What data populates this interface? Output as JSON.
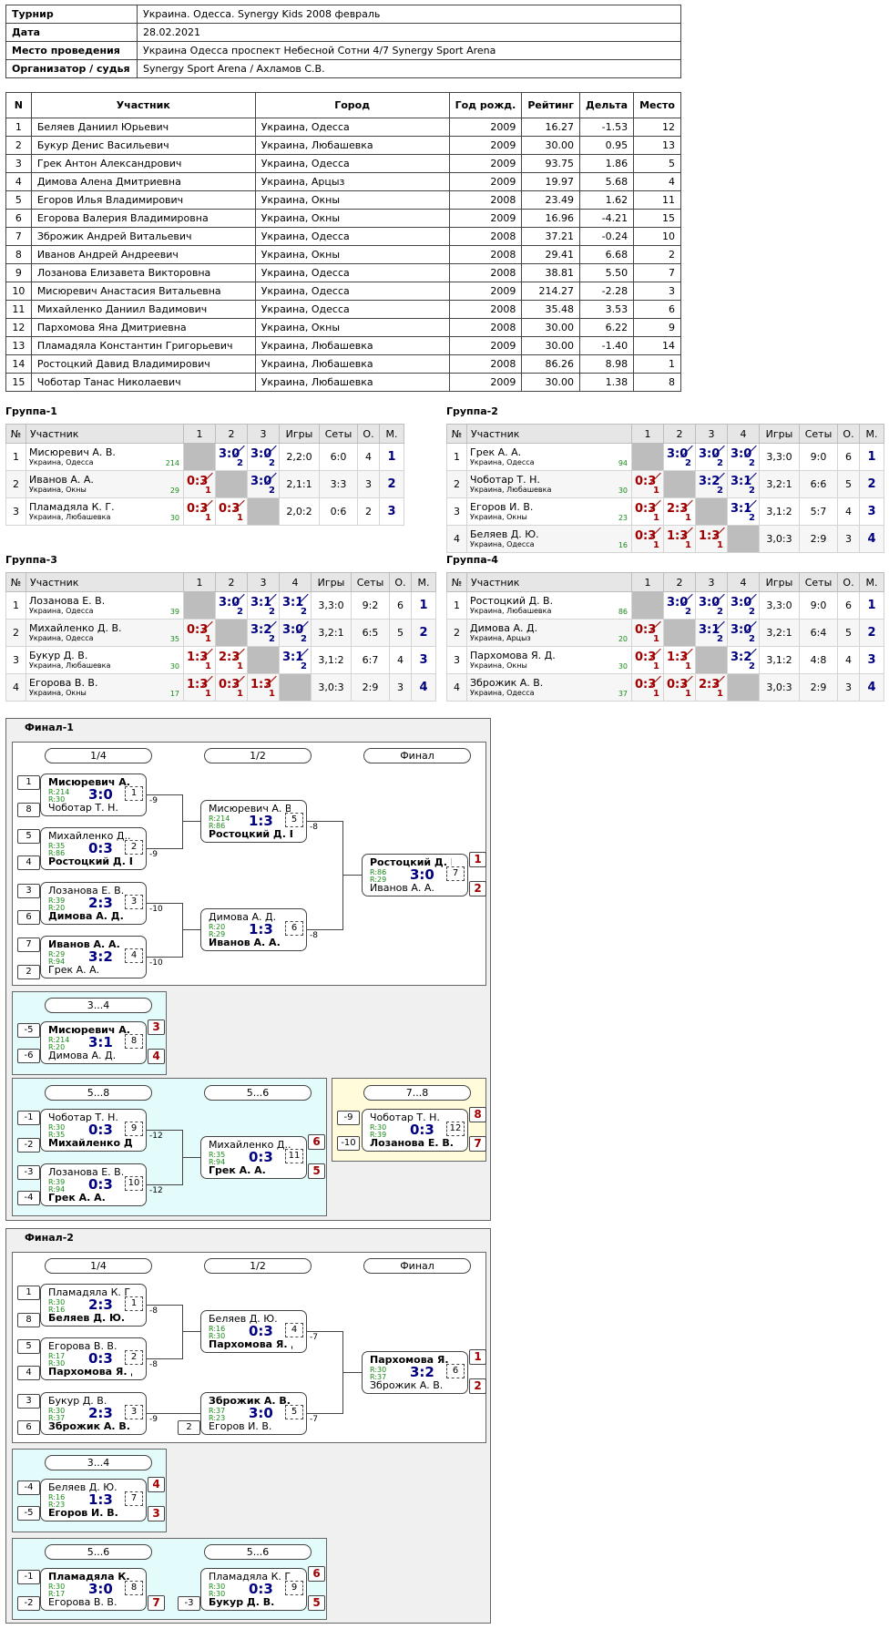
{
  "info": [
    [
      "Турнир",
      "Украина. Одесса. Synergy Kids 2008 февраль"
    ],
    [
      "Дата",
      "28.02.2021"
    ],
    [
      "Место проведения",
      "Украина Одесса проспект Небесной Сотни 4/7 Synergy Sport Arena"
    ],
    [
      "Организатор / судья",
      "Synergy Sport Arena / Ахламов С.В."
    ]
  ],
  "main": {
    "headers": [
      "N",
      "Участник",
      "Город",
      "Год рожд.",
      "Рейтинг",
      "Дельта",
      "Место"
    ],
    "rows": [
      [
        "1",
        "Беляев Даниил Юрьевич",
        "Украина, Одесса",
        "2009",
        "16.27",
        "-1.53",
        "12"
      ],
      [
        "2",
        "Букур Денис Васильевич",
        "Украина, Любашевка",
        "2009",
        "30.00",
        "0.95",
        "13"
      ],
      [
        "3",
        "Грек Антон Александрович",
        "Украина, Одесса",
        "2009",
        "93.75",
        "1.86",
        "5"
      ],
      [
        "4",
        "Димова Алена Дмитриевна",
        "Украина, Арцыз",
        "2009",
        "19.97",
        "5.68",
        "4"
      ],
      [
        "5",
        "Егоров Илья Владимирович",
        "Украина, Окны",
        "2008",
        "23.49",
        "1.62",
        "11"
      ],
      [
        "6",
        "Егорова Валерия Владимировна",
        "Украина, Окны",
        "2009",
        "16.96",
        "-4.21",
        "15"
      ],
      [
        "7",
        "Зброжик Андрей Витальевич",
        "Украина, Одесса",
        "2008",
        "37.21",
        "-0.24",
        "10"
      ],
      [
        "8",
        "Иванов Андрей Андреевич",
        "Украина, Окны",
        "2008",
        "29.41",
        "6.68",
        "2"
      ],
      [
        "9",
        "Лозанова Елизавета Викторовна",
        "Украина, Одесса",
        "2008",
        "38.81",
        "5.50",
        "7"
      ],
      [
        "10",
        "Мисюревич Анастасия Витальевна",
        "Украина, Одесса",
        "2009",
        "214.27",
        "-2.28",
        "3"
      ],
      [
        "11",
        "Михайленко Даниил Вадимович",
        "Украина, Одесса",
        "2008",
        "35.48",
        "3.53",
        "6"
      ],
      [
        "12",
        "Пархомова Яна Дмитриевна",
        "Украина, Окны",
        "2008",
        "30.00",
        "6.22",
        "9"
      ],
      [
        "13",
        "Пламадяла Константин Григорьевич",
        "Украина, Любашевка",
        "2009",
        "30.00",
        "-1.40",
        "14"
      ],
      [
        "14",
        "Ростоцкий Давид Владимирович",
        "Украина, Любашевка",
        "2008",
        "86.26",
        "8.98",
        "1"
      ],
      [
        "15",
        "Чоботар Танас Николаевич",
        "Украина, Любашевка",
        "2009",
        "30.00",
        "1.38",
        "8"
      ]
    ]
  },
  "groups": [
    {
      "title": "Группа-1",
      "headers": [
        "№",
        "Участник",
        "1",
        "2",
        "3",
        "Игры",
        "Сеты",
        "О.",
        "М."
      ],
      "rows": [
        {
          "n": "1",
          "name": "Мисюревич А. В.",
          "city": "Украина, Одесса",
          "r": "214",
          "sc": [
            null,
            [
              "3:0",
              "2",
              "w"
            ],
            [
              "3:0",
              "2",
              "w"
            ]
          ],
          "games": "2,2:0",
          "sets": "6:0",
          "pts": "4",
          "place": "1"
        },
        {
          "n": "2",
          "name": "Иванов А. А.",
          "city": "Украина, Окны",
          "r": "29",
          "sc": [
            [
              "0:3",
              "1",
              "l"
            ],
            null,
            [
              "3:0",
              "2",
              "w"
            ]
          ],
          "games": "2,1:1",
          "sets": "3:3",
          "pts": "3",
          "place": "2"
        },
        {
          "n": "3",
          "name": "Пламадяла К. Г.",
          "city": "Украина, Любашевка",
          "r": "30",
          "sc": [
            [
              "0:3",
              "1",
              "l"
            ],
            [
              "0:3",
              "1",
              "l"
            ],
            null
          ],
          "games": "2,0:2",
          "sets": "0:6",
          "pts": "2",
          "place": "3"
        }
      ]
    },
    {
      "title": "Группа-2",
      "headers": [
        "№",
        "Участник",
        "1",
        "2",
        "3",
        "4",
        "Игры",
        "Сеты",
        "О.",
        "М."
      ],
      "rows": [
        {
          "n": "1",
          "name": "Грек А. А.",
          "city": "Украина, Одесса",
          "r": "94",
          "sc": [
            null,
            [
              "3:0",
              "2",
              "w"
            ],
            [
              "3:0",
              "2",
              "w"
            ],
            [
              "3:0",
              "2",
              "w"
            ]
          ],
          "games": "3,3:0",
          "sets": "9:0",
          "pts": "6",
          "place": "1"
        },
        {
          "n": "2",
          "name": "Чоботар Т. Н.",
          "city": "Украина, Любашевка",
          "r": "30",
          "sc": [
            [
              "0:3",
              "1",
              "l"
            ],
            null,
            [
              "3:2",
              "2",
              "w"
            ],
            [
              "3:1",
              "2",
              "w"
            ]
          ],
          "games": "3,2:1",
          "sets": "6:6",
          "pts": "5",
          "place": "2"
        },
        {
          "n": "3",
          "name": "Егоров И. В.",
          "city": "Украина, Окны",
          "r": "23",
          "sc": [
            [
              "0:3",
              "1",
              "l"
            ],
            [
              "2:3",
              "1",
              "l"
            ],
            null,
            [
              "3:1",
              "2",
              "w"
            ]
          ],
          "games": "3,1:2",
          "sets": "5:7",
          "pts": "4",
          "place": "3"
        },
        {
          "n": "4",
          "name": "Беляев Д. Ю.",
          "city": "Украина, Одесса",
          "r": "16",
          "sc": [
            [
              "0:3",
              "1",
              "l"
            ],
            [
              "1:3",
              "1",
              "l"
            ],
            [
              "1:3",
              "1",
              "l"
            ],
            null
          ],
          "games": "3,0:3",
          "sets": "2:9",
          "pts": "3",
          "place": "4"
        }
      ]
    },
    {
      "title": "Группа-3",
      "headers": [
        "№",
        "Участник",
        "1",
        "2",
        "3",
        "4",
        "Игры",
        "Сеты",
        "О.",
        "М."
      ],
      "rows": [
        {
          "n": "1",
          "name": "Лозанова Е. В.",
          "city": "Украина, Одесса",
          "r": "39",
          "sc": [
            null,
            [
              "3:0",
              "2",
              "w"
            ],
            [
              "3:1",
              "2",
              "w"
            ],
            [
              "3:1",
              "2",
              "w"
            ]
          ],
          "games": "3,3:0",
          "sets": "9:2",
          "pts": "6",
          "place": "1"
        },
        {
          "n": "2",
          "name": "Михайленко Д. В.",
          "city": "Украина, Одесса",
          "r": "35",
          "sc": [
            [
              "0:3",
              "1",
              "l"
            ],
            null,
            [
              "3:2",
              "2",
              "w"
            ],
            [
              "3:0",
              "2",
              "w"
            ]
          ],
          "games": "3,2:1",
          "sets": "6:5",
          "pts": "5",
          "place": "2"
        },
        {
          "n": "3",
          "name": "Букур Д. В.",
          "city": "Украина, Любашевка",
          "r": "30",
          "sc": [
            [
              "1:3",
              "1",
              "l"
            ],
            [
              "2:3",
              "1",
              "l"
            ],
            null,
            [
              "3:1",
              "2",
              "w"
            ]
          ],
          "games": "3,1:2",
          "sets": "6:7",
          "pts": "4",
          "place": "3"
        },
        {
          "n": "4",
          "name": "Егорова В. В.",
          "city": "Украина, Окны",
          "r": "17",
          "sc": [
            [
              "1:3",
              "1",
              "l"
            ],
            [
              "0:3",
              "1",
              "l"
            ],
            [
              "1:3",
              "1",
              "l"
            ],
            null
          ],
          "games": "3,0:3",
          "sets": "2:9",
          "pts": "3",
          "place": "4"
        }
      ]
    },
    {
      "title": "Группа-4",
      "headers": [
        "№",
        "Участник",
        "1",
        "2",
        "3",
        "4",
        "Игры",
        "Сеты",
        "О.",
        "М."
      ],
      "rows": [
        {
          "n": "1",
          "name": "Ростоцкий Д. В.",
          "city": "Украина, Любашевка",
          "r": "86",
          "sc": [
            null,
            [
              "3:0",
              "2",
              "w"
            ],
            [
              "3:0",
              "2",
              "w"
            ],
            [
              "3:0",
              "2",
              "w"
            ]
          ],
          "games": "3,3:0",
          "sets": "9:0",
          "pts": "6",
          "place": "1"
        },
        {
          "n": "2",
          "name": "Димова А. Д.",
          "city": "Украина, Арцыз",
          "r": "20",
          "sc": [
            [
              "0:3",
              "1",
              "l"
            ],
            null,
            [
              "3:1",
              "2",
              "w"
            ],
            [
              "3:0",
              "2",
              "w"
            ]
          ],
          "games": "3,2:1",
          "sets": "6:4",
          "pts": "5",
          "place": "2"
        },
        {
          "n": "3",
          "name": "Пархомова Я. Д.",
          "city": "Украина, Окны",
          "r": "30",
          "sc": [
            [
              "0:3",
              "1",
              "l"
            ],
            [
              "1:3",
              "1",
              "l"
            ],
            null,
            [
              "3:2",
              "2",
              "w"
            ]
          ],
          "games": "3,1:2",
          "sets": "4:8",
          "pts": "4",
          "place": "3"
        },
        {
          "n": "4",
          "name": "Зброжик А. В.",
          "city": "Украина, Одесса",
          "r": "37",
          "sc": [
            [
              "0:3",
              "1",
              "l"
            ],
            [
              "0:3",
              "1",
              "l"
            ],
            [
              "2:3",
              "1",
              "l"
            ],
            null
          ],
          "games": "3,0:3",
          "sets": "2:9",
          "pts": "3",
          "place": "4"
        }
      ]
    }
  ],
  "finals": [
    {
      "title": "Финал-1",
      "labels": [
        "1/4",
        "1/2",
        "Финал",
        "3...4",
        "5...8",
        "5...6",
        "7...8"
      ],
      "seeds": [
        "1",
        "8",
        "5",
        "4",
        "3",
        "6",
        "7",
        "2",
        "-5",
        "-6",
        "-1",
        "-2",
        "-3",
        "-4",
        "-9",
        "-10"
      ],
      "matches": [
        {
          "p1": "Мисюревич А. В.",
          "p2": "Чоботар Т. Н.",
          "r1": "R:214",
          "r2": "R:30",
          "score": "3:0",
          "num": "1",
          "lose": "-9",
          "win": 1
        },
        {
          "p1": "Михайленко Д...",
          "p2": "Ростоцкий Д. В.",
          "r1": "R:35",
          "r2": "R:86",
          "score": "0:3",
          "num": "2",
          "lose": "-9",
          "win": 2
        },
        {
          "p1": "Лозанова Е. В.",
          "p2": "Димова А. Д.",
          "r1": "R:39",
          "r2": "R:20",
          "score": "2:3",
          "num": "3",
          "lose": "-10",
          "win": 2
        },
        {
          "p1": "Иванов А. А.",
          "p2": "Грек А. А.",
          "r1": "R:29",
          "r2": "R:94",
          "score": "3:2",
          "num": "4",
          "lose": "-10",
          "win": 1
        },
        {
          "p1": "Мисюревич А. В.",
          "p2": "Ростоцкий Д. В.",
          "r1": "R:214",
          "r2": "R:86",
          "score": "1:3",
          "num": "5",
          "lose": "-8",
          "win": 2
        },
        {
          "p1": "Димова А. Д.",
          "p2": "Иванов А. А.",
          "r1": "R:20",
          "r2": "R:29",
          "score": "1:3",
          "num": "6",
          "lose": "-8",
          "win": 2
        },
        {
          "p1": "Ростоцкий Д. В.",
          "p2": "Иванов А. А.",
          "r1": "R:86",
          "r2": "R:29",
          "score": "3:0",
          "num": "7",
          "win": 1,
          "res": [
            "1",
            "2"
          ]
        },
        {
          "p1": "Мисюревич А. В.",
          "p2": "Димова А. Д.",
          "r1": "R:214",
          "r2": "R:20",
          "score": "3:1",
          "num": "8",
          "win": 1,
          "res": [
            "3",
            "4"
          ]
        },
        {
          "p1": "Чоботар Т. Н.",
          "p2": "Михайленко Д....",
          "r1": "R:30",
          "r2": "R:35",
          "score": "0:3",
          "num": "9",
          "lose": "-12",
          "win": 2
        },
        {
          "p1": "Лозанова Е. В.",
          "p2": "Грек А. А.",
          "r1": "R:39",
          "r2": "R:94",
          "score": "0:3",
          "num": "10",
          "lose": "-12",
          "win": 2
        },
        {
          "p1": "Михайленко Д...",
          "p2": "Грек А. А.",
          "r1": "R:35",
          "r2": "R:94",
          "score": "0:3",
          "num": "11",
          "win": 2,
          "res": [
            "6",
            "5"
          ]
        },
        {
          "p1": "Чоботар Т. Н.",
          "p2": "Лозанова Е. В.",
          "r1": "R:30",
          "r2": "R:39",
          "score": "0:3",
          "num": "12",
          "win": 2,
          "res": [
            "8",
            "7"
          ]
        }
      ]
    },
    {
      "title": "Финал-2",
      "labels": [
        "1/4",
        "1/2",
        "Финал",
        "3...4",
        "5...6"
      ],
      "seeds": [
        "1",
        "8",
        "5",
        "4",
        "3",
        "6",
        "2",
        "-4",
        "-5",
        "-1",
        "-2",
        "-3"
      ],
      "matches": [
        {
          "p1": "Пламадяла К. Г.",
          "p2": "Беляев Д. Ю.",
          "r1": "R:30",
          "r2": "R:16",
          "score": "2:3",
          "num": "1",
          "lose": "-8",
          "win": 2
        },
        {
          "p1": "Егорова В. В.",
          "p2": "Пархомова Я. Д.",
          "r1": "R:17",
          "r2": "R:30",
          "score": "0:3",
          "num": "2",
          "lose": "-8",
          "win": 2
        },
        {
          "p1": "Букур Д. В.",
          "p2": "Зброжик А. В.",
          "r1": "R:30",
          "r2": "R:37",
          "score": "2:3",
          "num": "3",
          "lose": "-9",
          "win": 2
        },
        {
          "p1": "Беляев Д. Ю.",
          "p2": "Пархомова Я. Д.",
          "r1": "R:16",
          "r2": "R:30",
          "score": "0:3",
          "num": "4",
          "lose": "-7",
          "win": 2
        },
        {
          "p1": "Зброжик А. В.",
          "p2": "Егоров И. В.",
          "r1": "R:37",
          "r2": "R:23",
          "score": "3:0",
          "num": "5",
          "lose": "-7",
          "win": 1
        },
        {
          "p1": "Пархомова Я. Д.",
          "p2": "Зброжик А. В.",
          "r1": "R:30",
          "r2": "R:37",
          "score": "3:2",
          "num": "6",
          "win": 1,
          "res": [
            "1",
            "2"
          ]
        },
        {
          "p1": "Беляев Д. Ю.",
          "p2": "Егоров И. В.",
          "r1": "R:16",
          "r2": "R:23",
          "score": "1:3",
          "num": "7",
          "win": 2,
          "res": [
            "4",
            "3"
          ]
        },
        {
          "p1": "Пламадяла К. Г.",
          "p2": "Егорова В. В.",
          "r1": "R:30",
          "r2": "R:17",
          "score": "3:0",
          "num": "8",
          "win": 1,
          "res": [
            "7"
          ]
        },
        {
          "p1": "Пламадяла К. Г.",
          "p2": "Букур Д. В.",
          "r1": "R:30",
          "r2": "R:30",
          "score": "0:3",
          "num": "9",
          "win": 2,
          "res": [
            "6",
            "5"
          ]
        }
      ]
    }
  ]
}
